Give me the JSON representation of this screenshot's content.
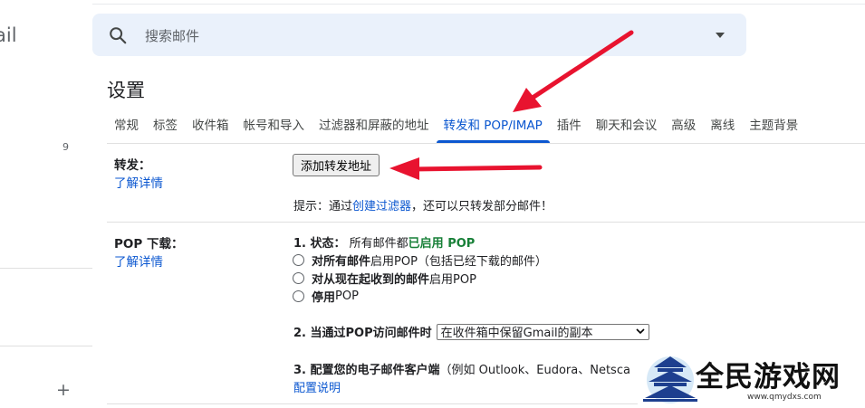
{
  "app": {
    "logo_partial": "ail",
    "left_count": "9",
    "add_icon": "plus-icon"
  },
  "search": {
    "placeholder": "搜索邮件",
    "icon": "search-icon"
  },
  "settings": {
    "title": "设置",
    "tabs": [
      {
        "label": "常规",
        "active": false
      },
      {
        "label": "标签",
        "active": false
      },
      {
        "label": "收件箱",
        "active": false
      },
      {
        "label": "帐号和导入",
        "active": false
      },
      {
        "label": "过滤器和屏蔽的地址",
        "active": false
      },
      {
        "label": "转发和 POP/IMAP",
        "active": true
      },
      {
        "label": "插件",
        "active": false
      },
      {
        "label": "聊天和会议",
        "active": false
      },
      {
        "label": "高级",
        "active": false
      },
      {
        "label": "离线",
        "active": false
      },
      {
        "label": "主题背景",
        "active": false
      }
    ]
  },
  "forwarding": {
    "label": "转发：",
    "learn_more": "了解详情",
    "add_button": "添加转发地址",
    "hint_prefix": "提示：通过",
    "hint_link": "创建过滤器",
    "hint_suffix": "，还可以只转发部分邮件！"
  },
  "pop": {
    "label": "POP 下载：",
    "learn_more": "了解详情",
    "status_num": "1. 状态：",
    "status_text": "所有邮件都",
    "status_value": "已启用 POP",
    "options": [
      {
        "bold": "对所有邮件",
        "rest": "启用POP（包括已经下载的邮件）"
      },
      {
        "bold": "对从现在起收到的邮件",
        "rest": "启用POP"
      },
      {
        "bold": "停用",
        "rest": "POP"
      }
    ],
    "access_label": "2. 当通过POP访问邮件时",
    "access_value": "在收件箱中保留Gmail的副本",
    "client_label": "3. 配置您的电子邮件客户端",
    "client_text": "（例如 Outlook、Eudora、Netsca",
    "client_link": "配置说明"
  },
  "watermark": {
    "text": "全民游戏网",
    "url": "www.qmydxs.com"
  },
  "colors": {
    "accent": "#0b57d0",
    "enabled_green": "#188038",
    "annotation_red": "#e8132f",
    "search_bg": "#eaf1fb"
  }
}
